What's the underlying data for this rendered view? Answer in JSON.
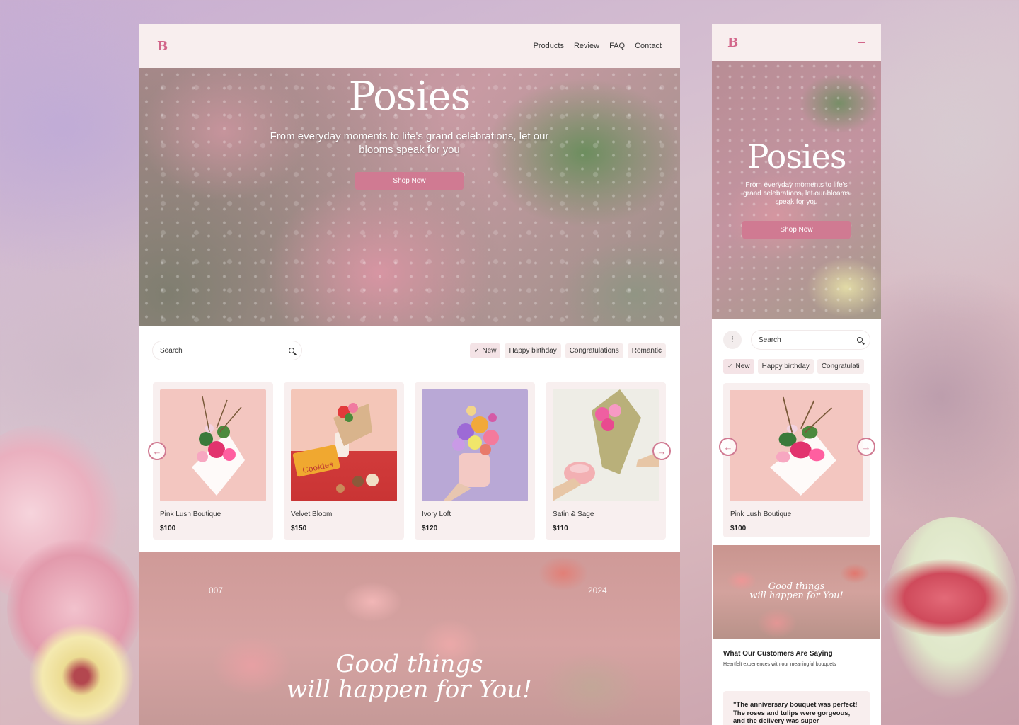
{
  "desktop": {
    "logo": "B",
    "nav": [
      "Products",
      "Review",
      "FAQ",
      "Contact"
    ],
    "hero": {
      "title": "Posies",
      "subtitle": "From everyday moments to life's grand celebrations, let our blooms speak for you",
      "cta": "Shop Now"
    },
    "search": {
      "placeholder": "Search"
    },
    "chips": [
      "New",
      "Happy birthday",
      "Congratulations",
      "Romantic"
    ],
    "products": [
      {
        "name": "Pink Lush Boutique",
        "price": "$100"
      },
      {
        "name": "Velvet Bloom",
        "price": "$150"
      },
      {
        "name": "Ivory Loft",
        "price": "$120"
      },
      {
        "name": "Satin & Sage",
        "price": "$110"
      }
    ],
    "banner": {
      "left_number": "007",
      "right_number": "2024",
      "line1": "Good things",
      "line2": "will happen for You!"
    }
  },
  "mobile": {
    "logo": "B",
    "hero": {
      "title": "Posies",
      "subtitle": "From everyday moments to life's grand celebrations, let our blooms speak for you",
      "cta": "Shop Now"
    },
    "search": {
      "placeholder": "Search"
    },
    "chips": [
      "New",
      "Happy birthday",
      "Congratulati"
    ],
    "product": {
      "name": "Pink Lush Boutique",
      "price": "$100"
    },
    "banner": {
      "line1": "Good things",
      "line2": "will happen for You!"
    },
    "testimonials": {
      "title": "What Our Customers Are Saying",
      "subtitle": "Heartfelt experiences with our meaningful bouquets",
      "quote": "\"The anniversary bouquet was perfect! The roses and tulips were gorgeous, and the delivery was super"
    }
  },
  "colors": {
    "accent": "#d07a92",
    "logo": "#d2668a",
    "nav_bg": "#f8eeee",
    "card_bg": "#f8efef"
  }
}
